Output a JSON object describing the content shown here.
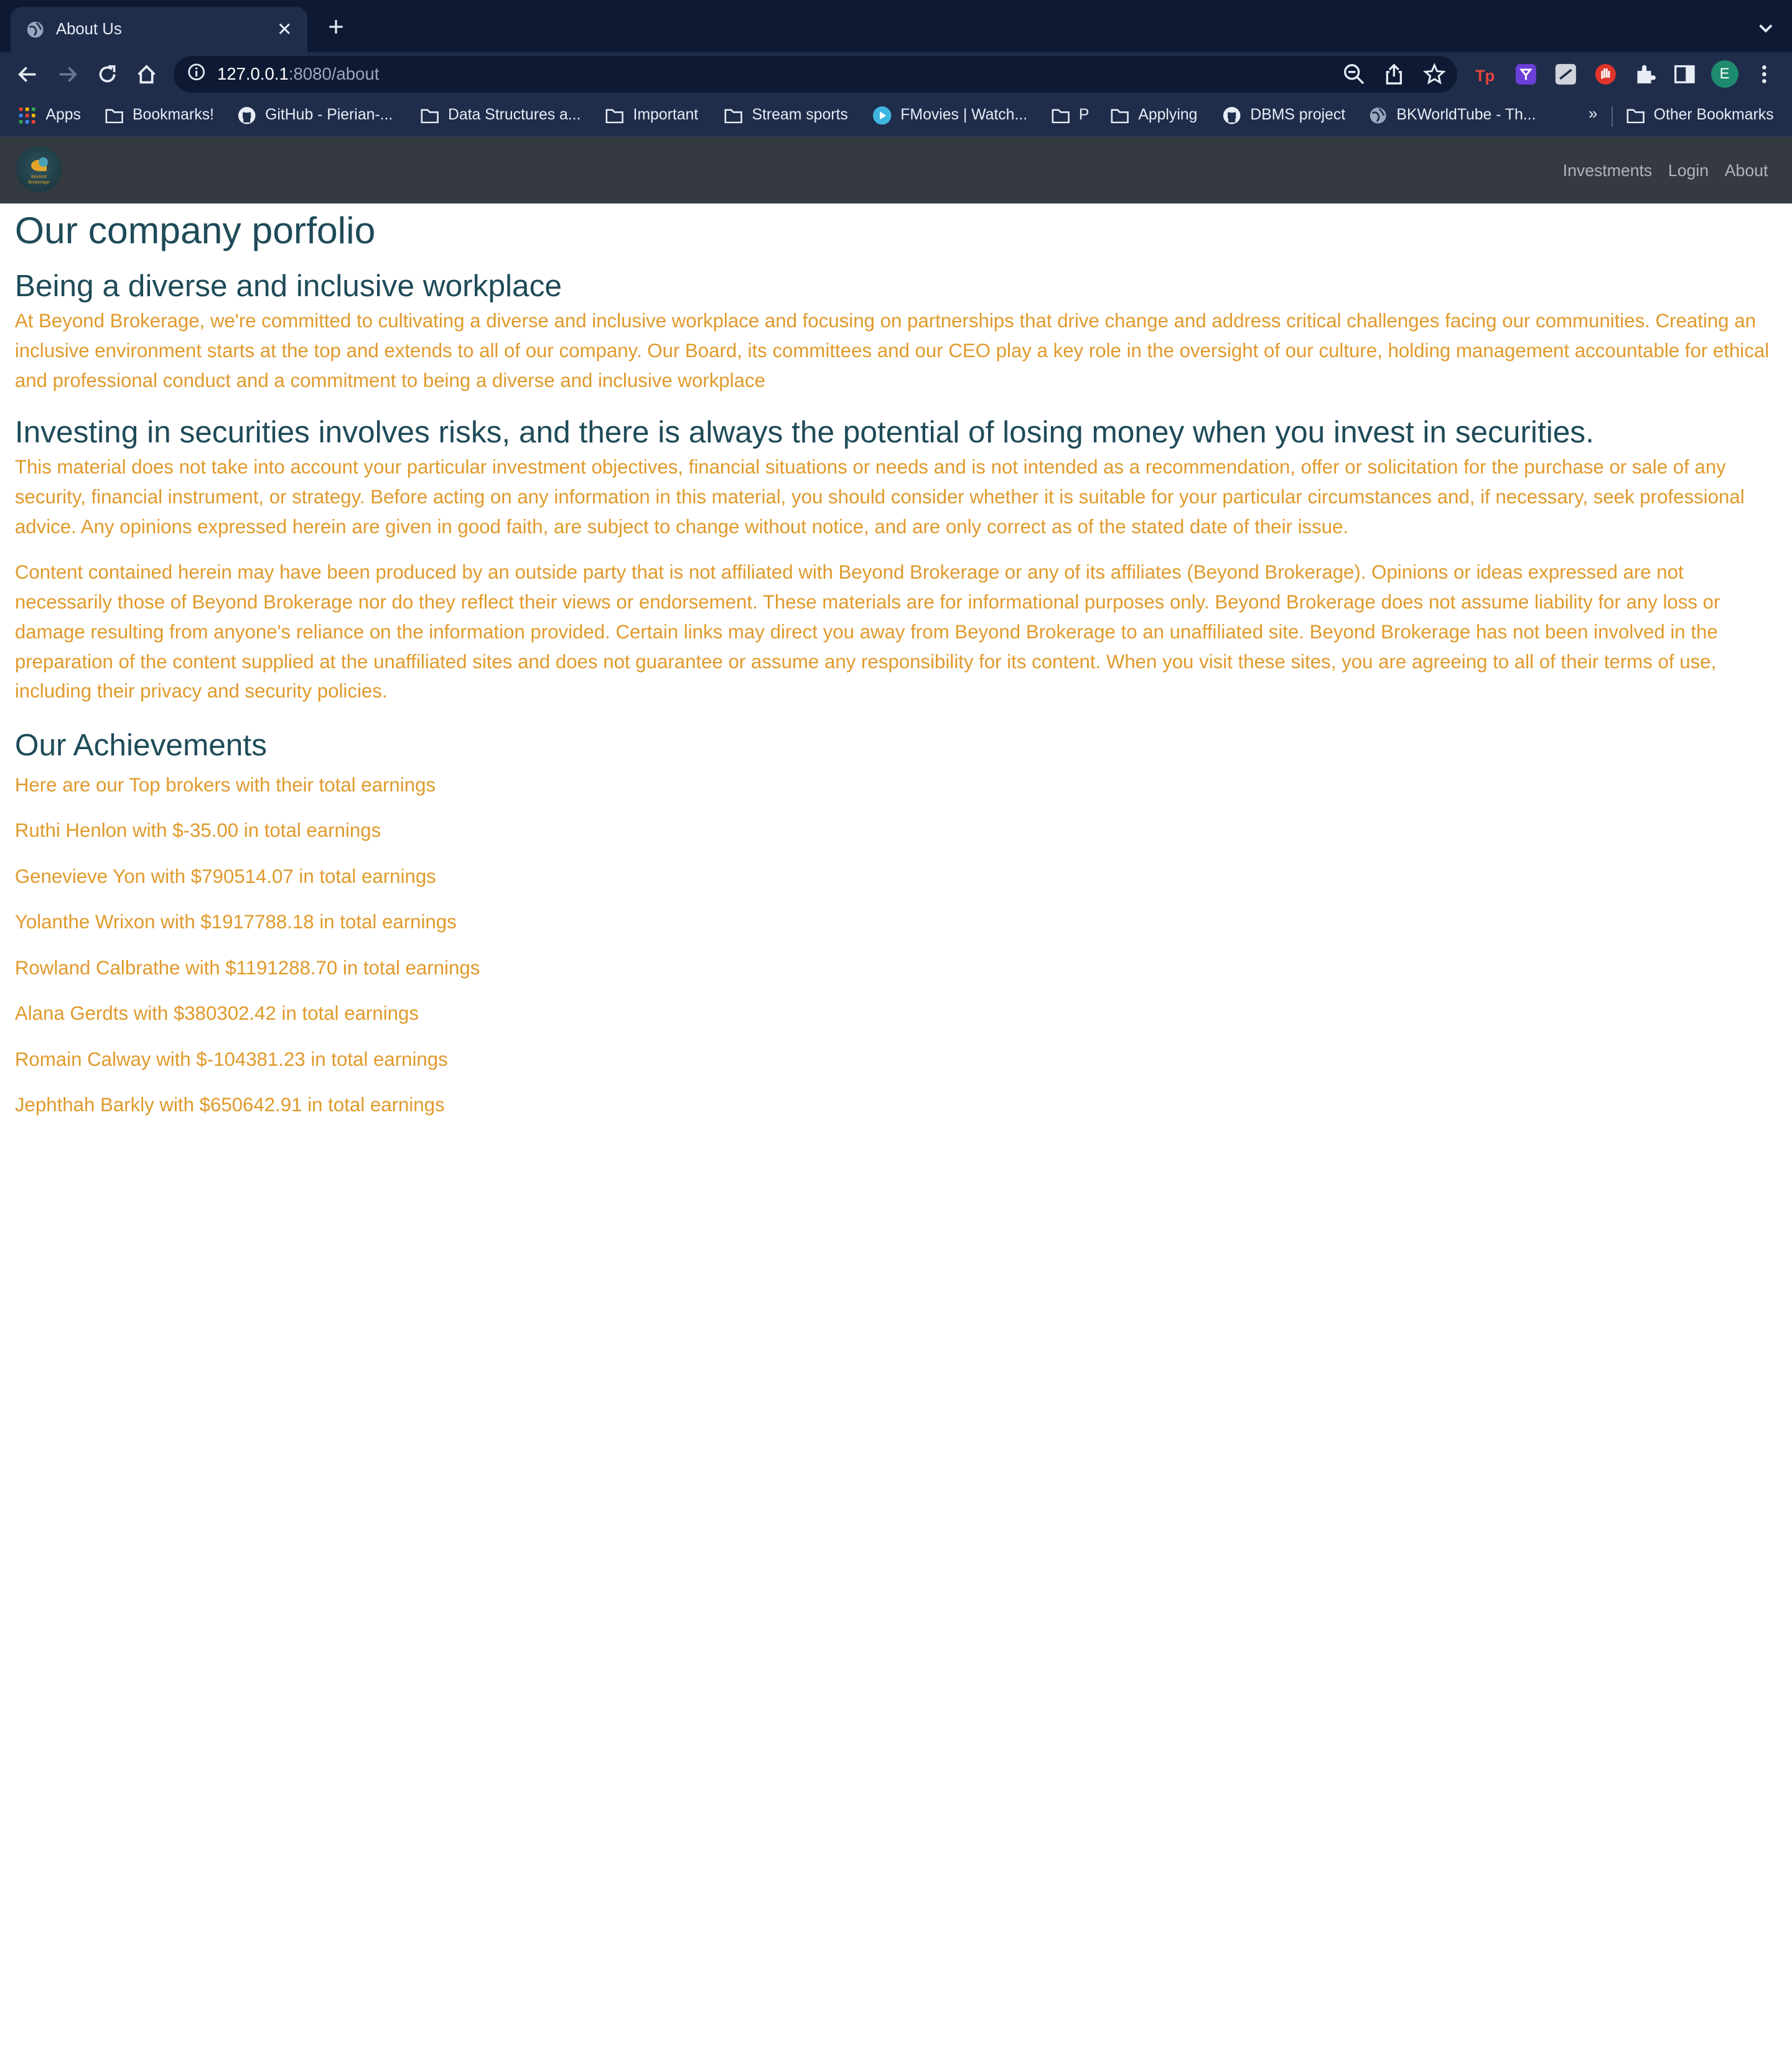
{
  "browser": {
    "tab_title": "About Us",
    "url_host": "127.0.0.1",
    "url_rest": ":8080/about",
    "profile_initial": "E",
    "bookmarks": [
      {
        "label": "Apps",
        "icon": "apps-grid-icon"
      },
      {
        "label": "Bookmarks!",
        "icon": "folder-icon"
      },
      {
        "label": "GitHub - Pierian-...",
        "icon": "github-icon"
      },
      {
        "label": "Data Structures a...",
        "icon": "folder-icon"
      },
      {
        "label": "Important",
        "icon": "folder-icon"
      },
      {
        "label": "Stream sports",
        "icon": "folder-icon"
      },
      {
        "label": "FMovies | Watch...",
        "icon": "play-icon"
      },
      {
        "label": "P",
        "icon": "folder-icon"
      },
      {
        "label": "Applying",
        "icon": "folder-icon"
      },
      {
        "label": "DBMS project",
        "icon": "github-icon"
      },
      {
        "label": "BKWorldTube - Th...",
        "icon": "globe-icon"
      }
    ],
    "bookmarks_more": "»",
    "other_bookmarks": "Other Bookmarks"
  },
  "site": {
    "logo_text": "Beyond Brokerage",
    "nav": [
      "Investments",
      "Login",
      "About"
    ]
  },
  "content": {
    "title": "Our company porfolio",
    "diversity_heading": "Being a diverse and inclusive workplace",
    "diversity_text": "At Beyond Brokerage, we're committed to cultivating a diverse and inclusive workplace and focusing on partnerships that drive change and address critical challenges facing our communities. Creating an inclusive environment starts at the top and extends to all of our company. Our Board, its committees and our CEO play a key role in the oversight of our culture, holding management accountable for ethical and professional conduct and a commitment to being a diverse and inclusive workplace",
    "risk_heading": "Investing in securities involves risks, and there is always the potential of losing money when you invest in securities.",
    "risk_text_1": "This material does not take into account your particular investment objectives, financial situations or needs and is not intended as a recommendation, offer or solicitation for the purchase or sale of any security, financial instrument, or strategy. Before acting on any information in this material, you should consider whether it is suitable for your particular circumstances and, if necessary, seek professional advice. Any opinions expressed herein are given in good faith, are subject to change without notice, and are only correct as of the stated date of their issue.",
    "risk_text_2": "Content contained herein may have been produced by an outside party that is not affiliated with Beyond Brokerage or any of its affiliates (Beyond Brokerage). Opinions or ideas expressed are not necessarily those of Beyond Brokerage nor do they reflect their views or endorsement. These materials are for informational purposes only. Beyond Brokerage does not assume liability for any loss or damage resulting from anyone's reliance on the information provided. Certain links may direct you away from Beyond Brokerage to an unaffiliated site. Beyond Brokerage has not been involved in the preparation of the content supplied at the unaffiliated sites and does not guarantee or assume any responsibility for its content. When you visit these sites, you are agreeing to all of their terms of use, including their privacy and security policies.",
    "achievements_heading": "Our Achievements",
    "achievements_intro": "Here are our Top brokers with their total earnings",
    "brokers": [
      "Ruthi Henlon with $-35.00 in total earnings",
      "Genevieve Yon with $790514.07 in total earnings",
      "Yolanthe Wrixon with $1917788.18 in total earnings",
      "Rowland Calbrathe with $1191288.70 in total earnings",
      "Alana Gerdts with $380302.42 in total earnings",
      "Romain Calway with $-104381.23 in total earnings",
      "Jephthah Barkly with $650642.91 in total earnings"
    ]
  }
}
